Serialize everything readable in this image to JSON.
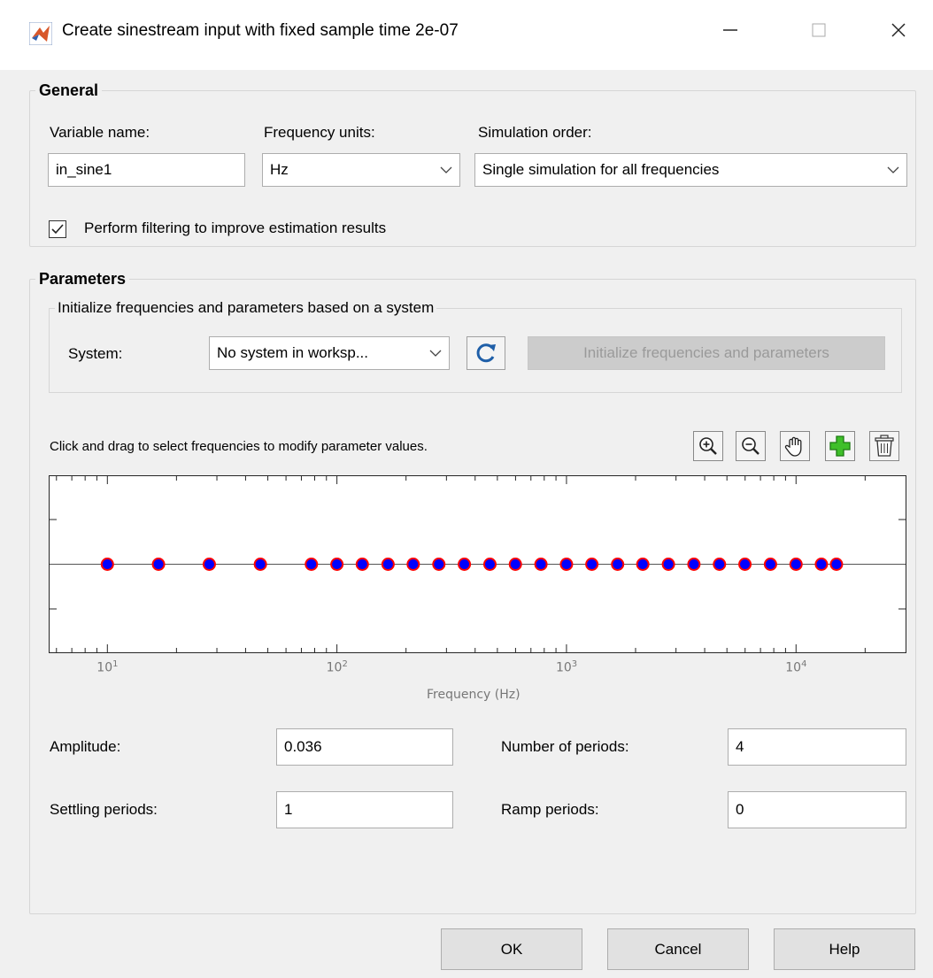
{
  "window": {
    "title": "Create sinestream input with fixed sample time 2e-07",
    "minimize": "—",
    "maximize": "☐",
    "close": "✕"
  },
  "general": {
    "legend": "General",
    "variable_name_label": "Variable name:",
    "variable_name_value": "in_sine1",
    "frequency_units_label": "Frequency units:",
    "frequency_units_value": "Hz",
    "simulation_order_label": "Simulation order:",
    "simulation_order_value": "Single simulation for all frequencies",
    "filter_checkbox_label": "Perform filtering to improve estimation results",
    "filter_checked": true
  },
  "parameters": {
    "legend": "Parameters",
    "init_group_legend": "Initialize frequencies and parameters based on a system",
    "system_label": "System:",
    "system_value": "No system in worksp...",
    "init_button": "Initialize frequencies and parameters",
    "instruction": "Click and drag to select frequencies to modify parameter values.",
    "toolbar_icons": [
      "zoom-in-icon",
      "zoom-out-icon",
      "pan-hand-icon",
      "add-icon",
      "delete-icon"
    ],
    "amplitude_label": "Amplitude:",
    "amplitude_value": "0.036",
    "periods_label": "Number of periods:",
    "periods_value": "4",
    "settling_label": "Settling periods:",
    "settling_value": "1",
    "ramp_label": "Ramp periods:",
    "ramp_value": "0"
  },
  "chart_data": {
    "type": "scatter",
    "xscale": "log",
    "xlim": [
      5.6,
      30000
    ],
    "xlabel": "Frequency (Hz)",
    "ticks": [
      {
        "base": "10",
        "exp": "1",
        "value": 10
      },
      {
        "base": "10",
        "exp": "2",
        "value": 100
      },
      {
        "base": "10",
        "exp": "3",
        "value": 1000
      },
      {
        "base": "10",
        "exp": "4",
        "value": 10000
      }
    ],
    "x": [
      10,
      16.7,
      27.8,
      46.4,
      77.4,
      100,
      129,
      167,
      215,
      278,
      359,
      464,
      599,
      774,
      1000,
      1290,
      1670,
      2150,
      2780,
      3590,
      4640,
      5990,
      7740,
      10000,
      12900,
      15000
    ],
    "marker_fill": "#0000ff",
    "marker_edge": "#ff0000"
  },
  "buttons": {
    "ok": "OK",
    "cancel": "Cancel",
    "help": "Help"
  },
  "colors": {
    "accent": "#0078d7",
    "marker_fill": "#0000ff",
    "marker_edge": "#ff0000"
  }
}
